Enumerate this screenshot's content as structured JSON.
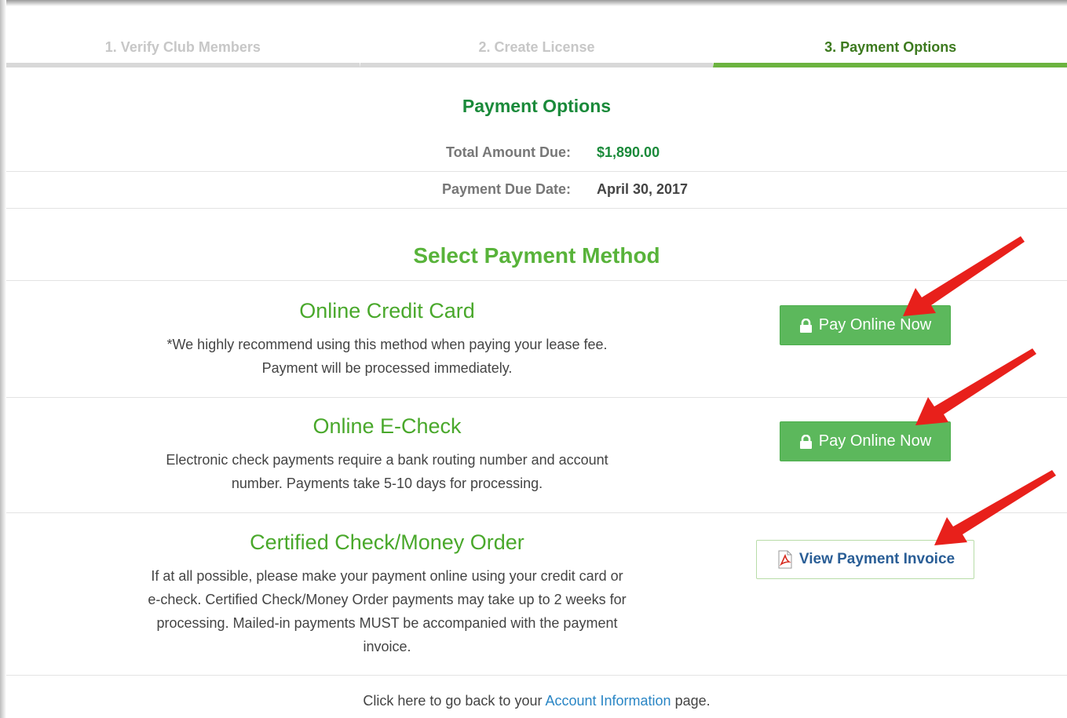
{
  "wizard": {
    "steps": [
      {
        "label": "1. Verify Club Members",
        "state": "completed"
      },
      {
        "label": "2. Create License",
        "state": "completed"
      },
      {
        "label": "3. Payment Options",
        "state": "active"
      }
    ]
  },
  "payment_options": {
    "title": "Payment Options",
    "total_label": "Total Amount Due:",
    "total_value": "$1,890.00",
    "due_label": "Payment Due Date:",
    "due_value": "April 30, 2017"
  },
  "select_method": {
    "title": "Select Payment Method",
    "methods": [
      {
        "name": "Online Credit Card",
        "desc_line1": "*We highly recommend using this method when paying your lease fee.",
        "desc_line2": "Payment will be processed immediately.",
        "button_label": "Pay Online Now"
      },
      {
        "name": "Online E-Check",
        "desc_line1": "Electronic check payments require a bank routing number and account",
        "desc_line2": "number. Payments take 5-10 days for processing.",
        "button_label": "Pay Online Now"
      },
      {
        "name": "Certified Check/Money Order",
        "desc_line1": "If at all possible, please make your payment online using your credit card or",
        "desc_line2": "e-check. Certified Check/Money Order payments may take up to 2 weeks for",
        "desc_line3": "processing. Mailed-in payments MUST be accompanied with the payment",
        "desc_line4": "invoice.",
        "button_label": "View Payment Invoice"
      }
    ]
  },
  "footer": {
    "prefix": "Click here to go back to your",
    "link": "Account Information",
    "suffix": "page."
  },
  "colors": {
    "accent_green": "#5cb85c",
    "title_green": "#1a8a3a",
    "method_green": "#49a82b",
    "link_blue": "#2a86c5",
    "annotation_red": "#e8201b"
  },
  "icons": {
    "pay_button_icon": "lock-icon",
    "invoice_button_icon": "pdf-icon",
    "annotation": "red-arrow-icon"
  }
}
